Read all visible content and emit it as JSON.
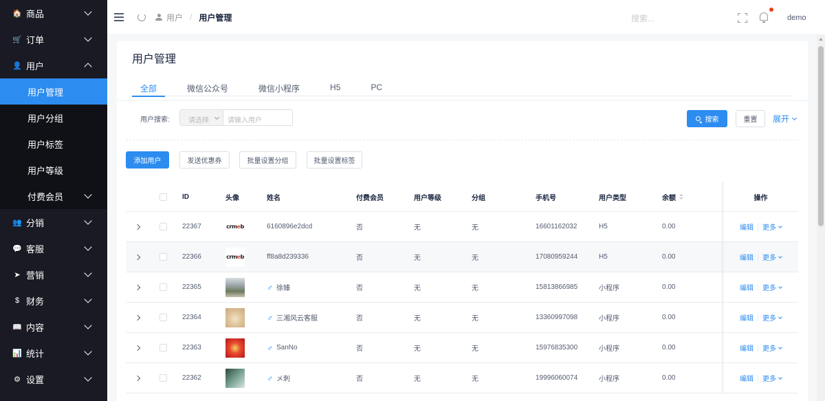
{
  "sidebar": {
    "items": [
      {
        "label": "商品",
        "icon": "shop-icon",
        "glyph": "🏠"
      },
      {
        "label": "订单",
        "icon": "cart-icon",
        "glyph": "🛒"
      },
      {
        "label": "用户",
        "icon": "user-icon",
        "glyph": "👤",
        "expanded": true,
        "children": [
          {
            "label": "用户管理",
            "active": true
          },
          {
            "label": "用户分组"
          },
          {
            "label": "用户标签"
          },
          {
            "label": "用户等级"
          },
          {
            "label": "付费会员",
            "has_children": true
          }
        ]
      },
      {
        "label": "分销",
        "icon": "distribution-icon",
        "glyph": "👥"
      },
      {
        "label": "客服",
        "icon": "chat-icon",
        "glyph": "💬"
      },
      {
        "label": "营销",
        "icon": "send-icon",
        "glyph": "➤"
      },
      {
        "label": "财务",
        "icon": "dollar-icon",
        "glyph": "$"
      },
      {
        "label": "内容",
        "icon": "book-icon",
        "glyph": "📖"
      },
      {
        "label": "统计",
        "icon": "chart-icon",
        "glyph": "📊"
      },
      {
        "label": "设置",
        "icon": "gear-icon",
        "glyph": "⚙"
      }
    ]
  },
  "header": {
    "breadcrumb_parent": "用户",
    "breadcrumb_separator": "/",
    "breadcrumb_current": "用户管理",
    "search_placeholder": "搜索...",
    "username": "demo"
  },
  "page": {
    "title": "用户管理",
    "tabs": [
      {
        "label": "全部",
        "active": true
      },
      {
        "label": "微信公众号"
      },
      {
        "label": "微信小程序"
      },
      {
        "label": "H5"
      },
      {
        "label": "PC"
      }
    ]
  },
  "filter": {
    "label": "用户搜索:",
    "select_placeholder": "请选择",
    "input_placeholder": "请输入用户",
    "search_button": "搜索",
    "reset_button": "重置",
    "expand_link": "展开"
  },
  "actions": {
    "add_user": "添加用户",
    "send_coupon": "发送优惠券",
    "batch_group": "批量设置分组",
    "batch_tag": "批量设置标签"
  },
  "table": {
    "columns": {
      "id": "ID",
      "avatar": "头像",
      "name": "姓名",
      "paid_member": "付费会员",
      "level": "用户等级",
      "group": "分组",
      "phone": "手机号",
      "user_type": "用户类型",
      "balance": "余额",
      "ops": "操作"
    },
    "edit_label": "编辑",
    "more_label": "更多",
    "rows": [
      {
        "id": "22367",
        "avatar": "crmeb-logo",
        "male": false,
        "name": "6160896e2dcd",
        "paid_member": "否",
        "level": "无",
        "group": "无",
        "phone": "16601162032",
        "user_type": "H5",
        "balance": "0.00"
      },
      {
        "id": "22366",
        "avatar": "crmeb-logo",
        "male": false,
        "name": "ff8a8d239336",
        "paid_member": "否",
        "level": "无",
        "group": "无",
        "phone": "17080959244",
        "user_type": "H5",
        "balance": "0.00"
      },
      {
        "id": "22365",
        "avatar": "photo-house",
        "male": true,
        "name": "徐臻",
        "paid_member": "否",
        "level": "无",
        "group": "无",
        "phone": "15813866985",
        "user_type": "小程序",
        "balance": "0.00"
      },
      {
        "id": "22364",
        "avatar": "photo-cat",
        "male": true,
        "name": "三湘风云客服",
        "paid_member": "否",
        "level": "无",
        "group": "无",
        "phone": "13360997098",
        "user_type": "小程序",
        "balance": "0.00"
      },
      {
        "id": "22363",
        "avatar": "photo-red",
        "male": true,
        "name": "SanNo",
        "paid_member": "否",
        "level": "无",
        "group": "无",
        "phone": "15976835300",
        "user_type": "小程序",
        "balance": "0.00"
      },
      {
        "id": "22362",
        "avatar": "photo-green",
        "male": true,
        "name": "メ刺",
        "paid_member": "否",
        "level": "无",
        "group": "无",
        "phone": "19996060074",
        "user_type": "小程序",
        "balance": "0.00"
      }
    ]
  },
  "colors": {
    "sidebar_bg": "#191a23",
    "submenu_bg": "#101117",
    "accent": "#2d8cf0",
    "notification_dot": "#ed4014"
  }
}
